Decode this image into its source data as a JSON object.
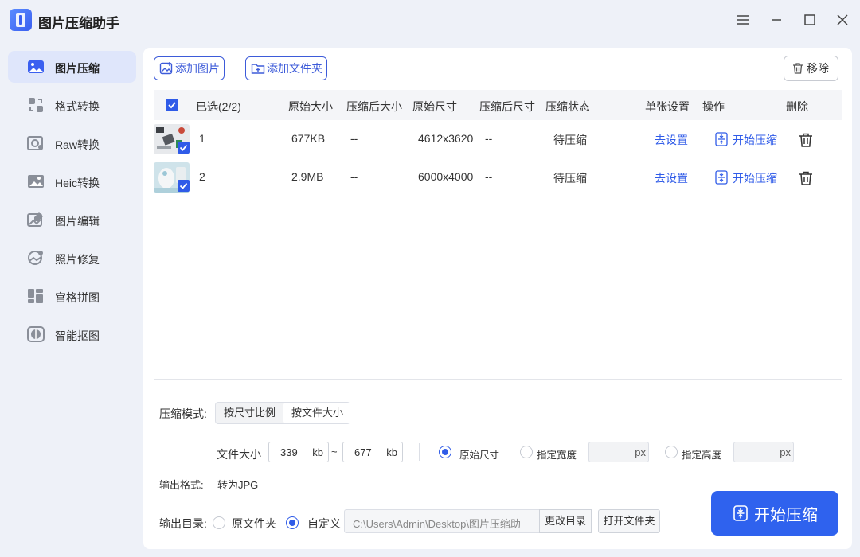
{
  "app": {
    "title": "图片压缩助手"
  },
  "sidebar": {
    "items": [
      {
        "label": "图片压缩",
        "icon": "image-compress-icon"
      },
      {
        "label": "格式转换",
        "icon": "format-convert-icon"
      },
      {
        "label": "Raw转换",
        "icon": "raw-convert-icon"
      },
      {
        "label": "Heic转换",
        "icon": "heic-convert-icon"
      },
      {
        "label": "图片编辑",
        "icon": "image-edit-icon"
      },
      {
        "label": "照片修复",
        "icon": "photo-repair-icon"
      },
      {
        "label": "宫格拼图",
        "icon": "grid-collage-icon"
      },
      {
        "label": "智能抠图",
        "icon": "smart-cutout-icon"
      }
    ],
    "active_index": 0
  },
  "toolbar": {
    "add_image": "添加图片",
    "add_folder": "添加文件夹",
    "remove": "移除"
  },
  "table": {
    "headers": {
      "selected": "已选(2/2)",
      "orig_size": "原始大小",
      "comp_size": "压缩后大小",
      "orig_dim": "原始尺寸",
      "comp_dim": "压缩后尺寸",
      "status": "压缩状态",
      "single": "单张设置",
      "action": "操作",
      "delete": "删除"
    },
    "rows": [
      {
        "index": "1",
        "orig_size": "677KB",
        "comp_size": "--",
        "orig_dim": "4612x3620",
        "comp_dim": "--",
        "status": "待压缩",
        "single": "去设置",
        "action": "开始压缩"
      },
      {
        "index": "2",
        "orig_size": "2.9MB",
        "comp_size": "--",
        "orig_dim": "6000x4000",
        "comp_dim": "--",
        "status": "待压缩",
        "single": "去设置",
        "action": "开始压缩"
      }
    ]
  },
  "settings": {
    "mode_label": "压缩模式:",
    "mode_options": [
      "按尺寸比例",
      "按文件大小"
    ],
    "mode_selected": "按文件大小",
    "filesize_label": "文件大小",
    "min_value": "339",
    "max_value": "677",
    "unit_kb": "kb",
    "tilde": "~",
    "orig_dim_option": "原始尺寸",
    "width_option": "指定宽度",
    "height_option": "指定高度",
    "unit_px": "px",
    "format_label": "输出格式:",
    "format_value": "转为JPG",
    "output_label": "输出目录:",
    "output_original": "原文件夹",
    "output_custom": "自定义",
    "output_path": "C:\\Users\\Admin\\Desktop\\图片压缩助",
    "change_dir": "更改目录",
    "open_folder": "打开文件夹",
    "start_button": "开始压缩"
  },
  "colors": {
    "accent": "#2f5be8",
    "start_button": "#2f62ee",
    "active_nav": "#dfe6fb"
  }
}
